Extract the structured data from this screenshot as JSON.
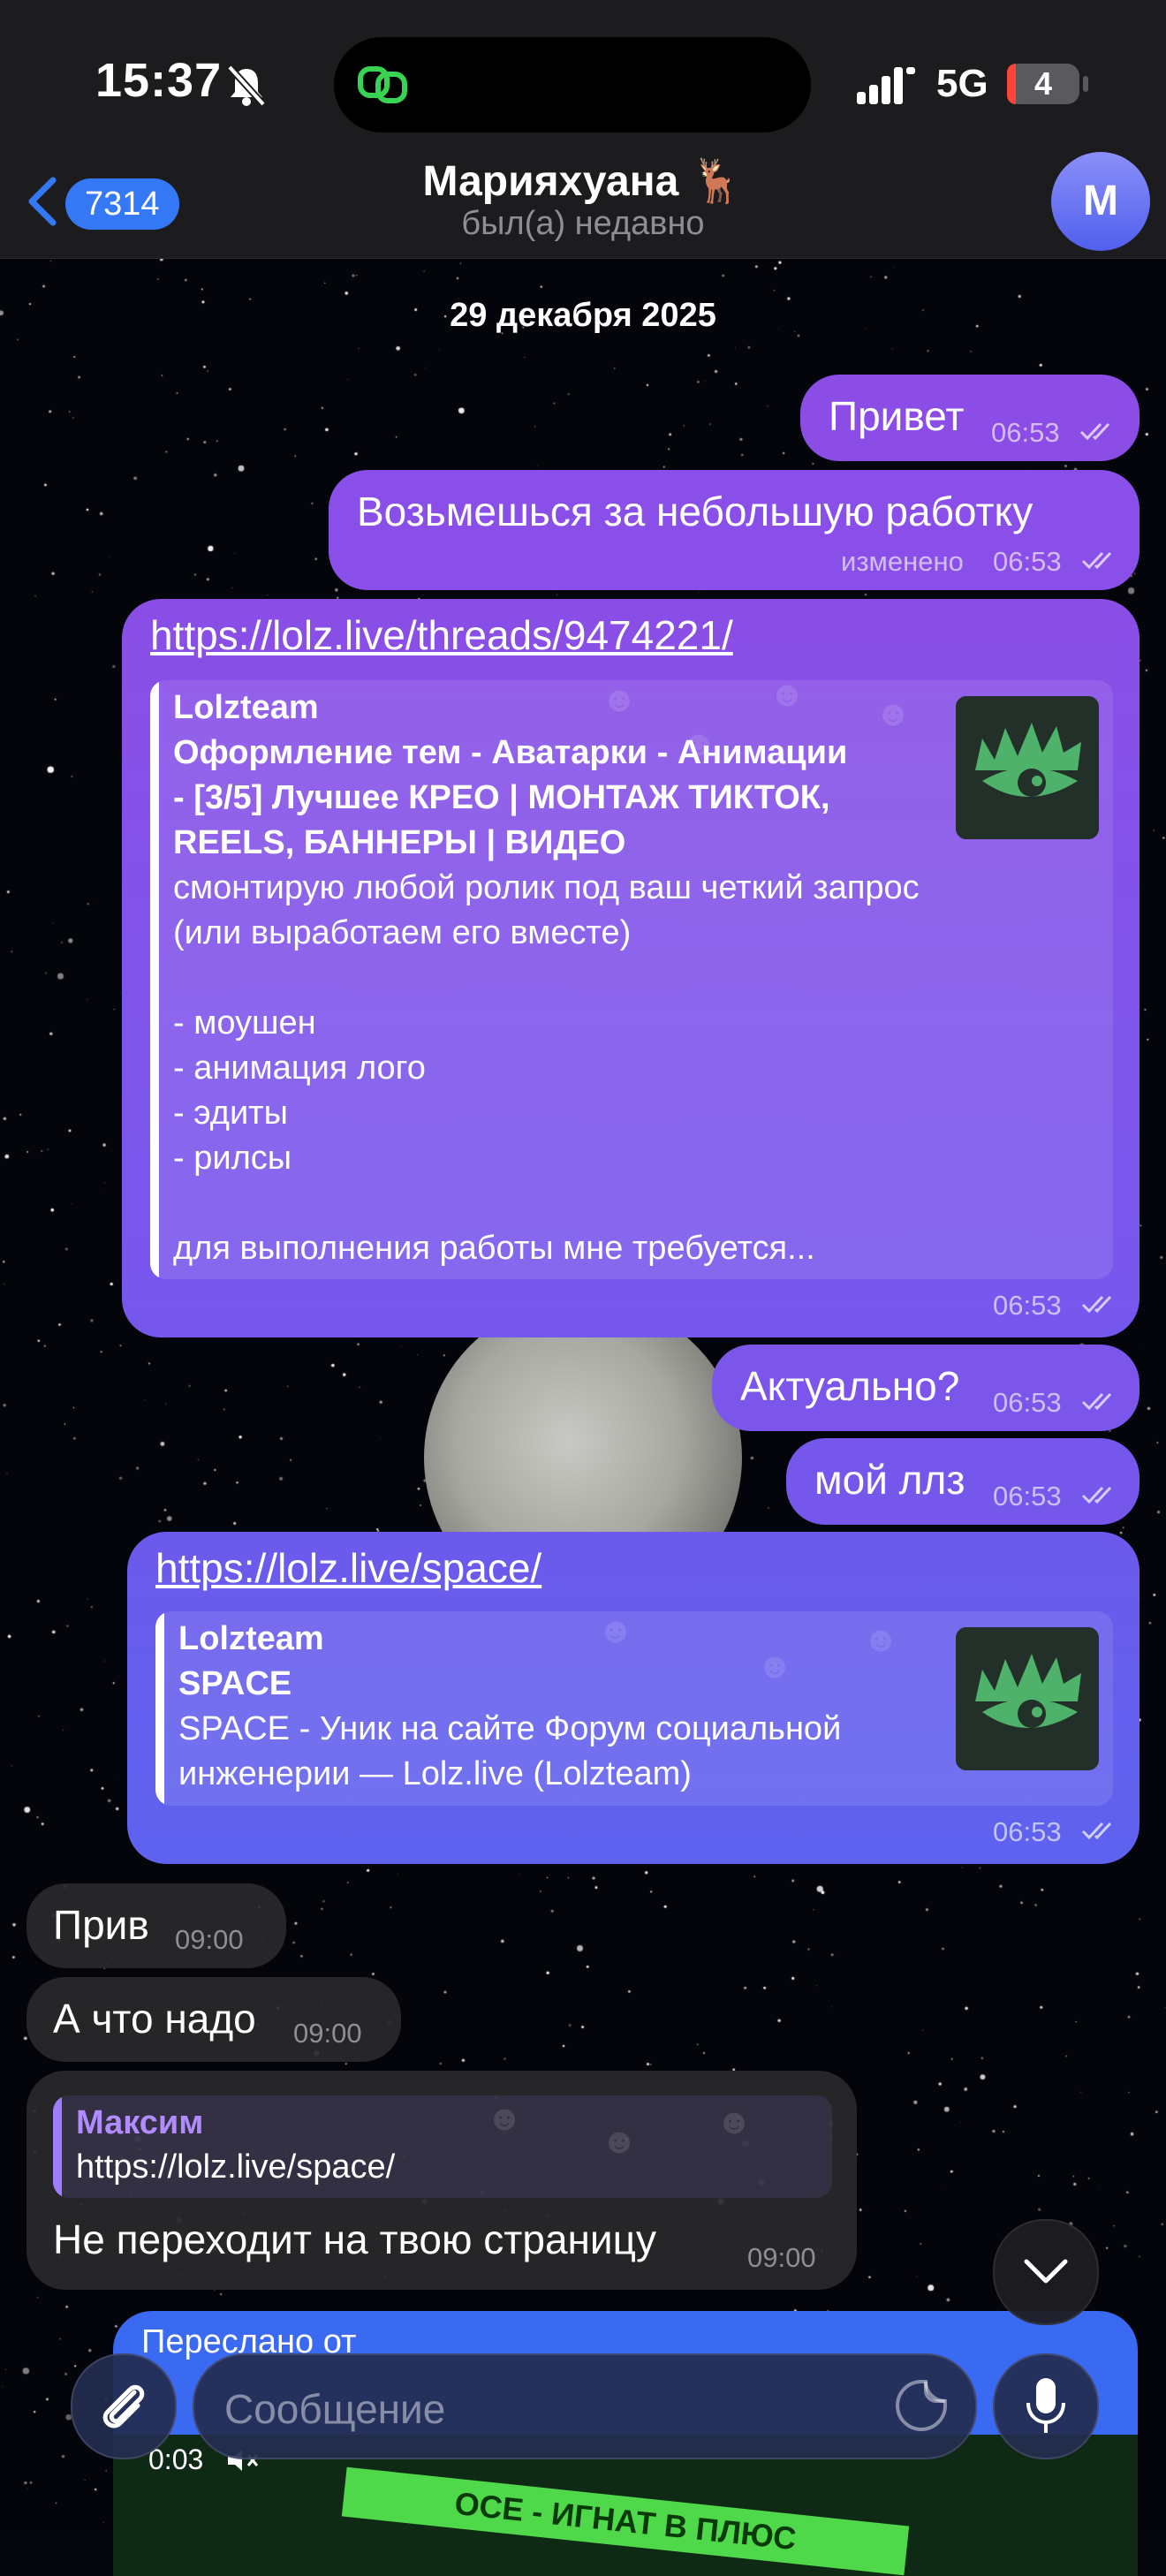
{
  "status_bar": {
    "time": "15:37",
    "network": "5G",
    "battery": "4",
    "battery_level_percent": 4,
    "icons": [
      "bell-slash-icon",
      "link-loop-icon",
      "cell-signal-icon",
      "battery-icon"
    ]
  },
  "header": {
    "back_count": "7314",
    "contact_name": "Марияхуана 🦌",
    "contact_status": "был(а) недавно",
    "avatar_letter": "M"
  },
  "chat": {
    "date": "29 декабря 2025",
    "messages": [
      {
        "text": "Привет",
        "time": "06:53"
      },
      {
        "text": "Возьмешься за небольшую работку",
        "time": "06:53",
        "edited": "изменено"
      },
      {
        "url": "https://lolz.live/threads/9474221/",
        "preview_site": "Lolzteam",
        "preview_title": [
          "Оформление тем - Аватарки - Анимации",
          "- [3/5] Лучшее КРЕО | МОНТАЖ ТИКТОК,",
          "REELS, БАННЕРЫ | ВИДЕО"
        ],
        "preview_desc": [
          "смонтирую любой ролик под ваш четкий запрос",
          "(или выработаем его вместе)",
          "",
          "- моушен",
          "- анимация лого",
          "- эдиты",
          "- рилсы",
          "",
          "для выполнения работы мне требуется..."
        ],
        "time": "06:53"
      },
      {
        "text": "Актуально?",
        "time": "06:53"
      },
      {
        "text": "мой ллз",
        "time": "06:53"
      },
      {
        "url": "https://lolz.live/space/",
        "preview_site": "Lolzteam",
        "preview_title": [
          "SPACE"
        ],
        "preview_desc": [
          "SPACE - Уник на сайте Форум социальной",
          "инженерии —  Lolz.live (Lolzteam)"
        ],
        "time": "06:53"
      },
      {
        "text": "Прив",
        "time": "09:00"
      },
      {
        "text": "А что надо",
        "time": "09:00"
      },
      {
        "reply_author": "Максим",
        "reply_text": "https://lolz.live/space/",
        "text": "Не переходит на твою страницу",
        "time": "09:00"
      }
    ],
    "forwarded": {
      "label": "Переслано от",
      "video_time": "0:03",
      "tape_text": "ОСЕ - ИГНАТ В ПЛЮС"
    }
  },
  "composer": {
    "placeholder": "Сообщение"
  },
  "colors": {
    "outgoing_top": "#8d4ce6",
    "outgoing_bottom": "#5a66ee",
    "incoming": "#28282c",
    "accent": "#3478f6",
    "reply_name": "#b08cff"
  }
}
